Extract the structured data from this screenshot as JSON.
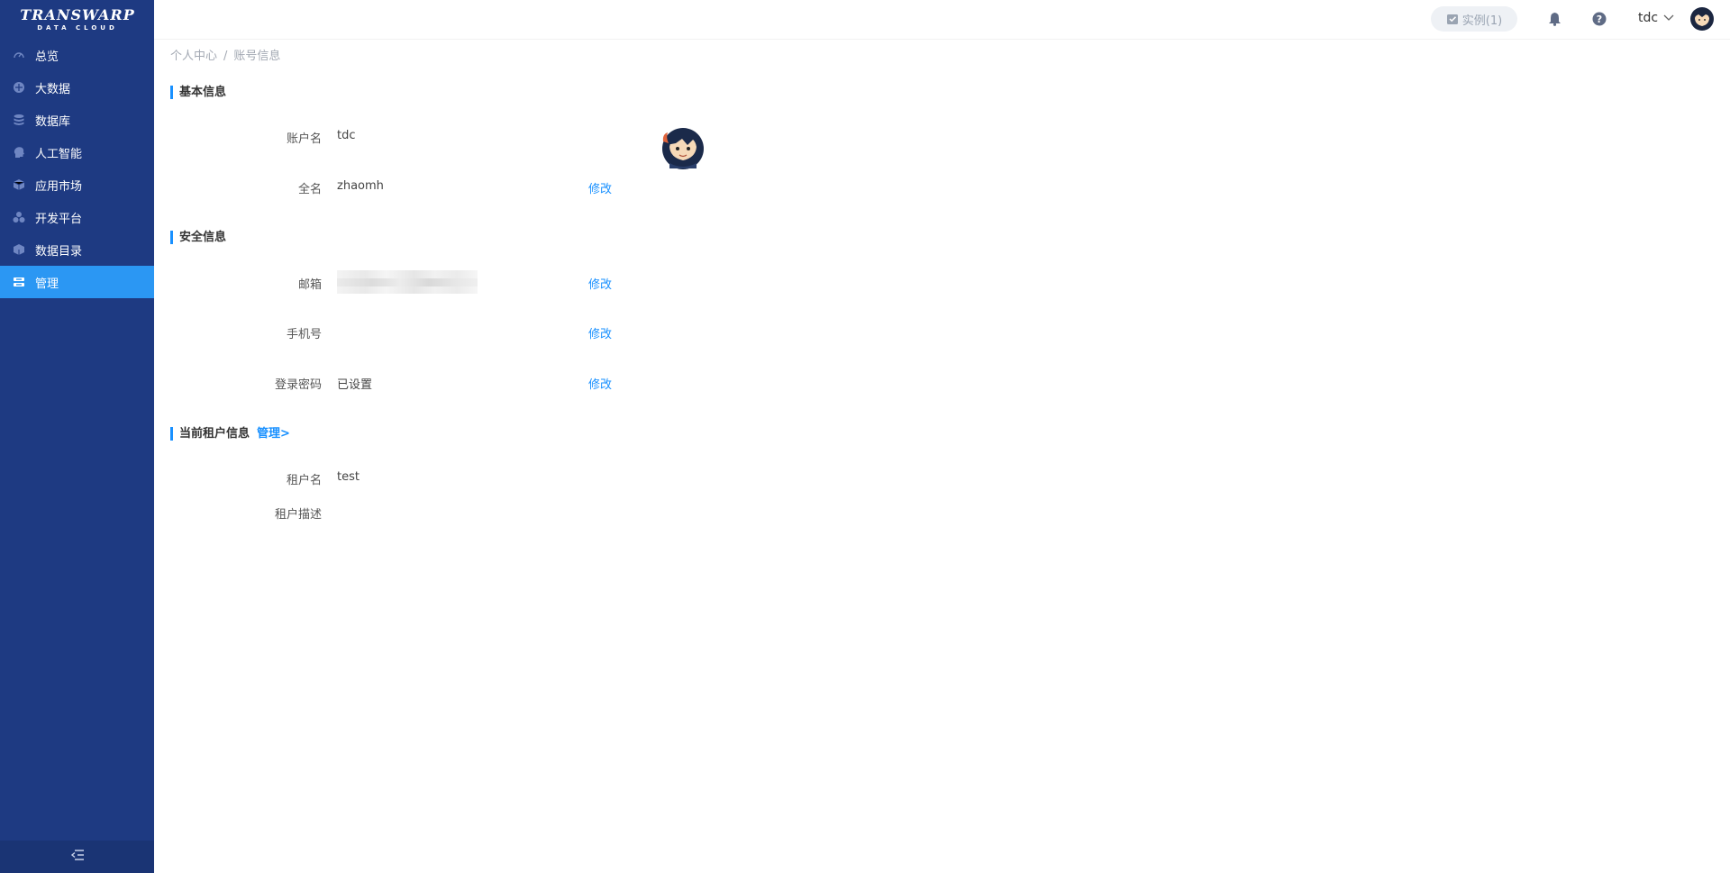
{
  "logo": {
    "line1": "TRANSWARP",
    "line2": "DATA CLOUD"
  },
  "sidebar": {
    "items": [
      {
        "label": "总览",
        "icon": "dashboard-gauge-icon",
        "active": false
      },
      {
        "label": "大数据",
        "icon": "big-data-icon",
        "active": false
      },
      {
        "label": "数据库",
        "icon": "database-icon",
        "active": false
      },
      {
        "label": "人工智能",
        "icon": "ai-head-icon",
        "active": false
      },
      {
        "label": "应用市场",
        "icon": "app-market-icon",
        "active": false
      },
      {
        "label": "开发平台",
        "icon": "dev-platform-icon",
        "active": false
      },
      {
        "label": "数据目录",
        "icon": "data-catalog-icon",
        "active": false
      },
      {
        "label": "管理",
        "icon": "management-icon",
        "active": true
      }
    ],
    "collapse_icon": "collapse-menu-icon"
  },
  "header": {
    "instances_label": "实例(1)",
    "notifications_icon": "bell-icon",
    "help_icon": "help-icon",
    "username": "tdc"
  },
  "breadcrumb": {
    "items": [
      "个人中心",
      "账号信息"
    ],
    "separator": "/"
  },
  "basic_info": {
    "title": "基本信息",
    "account_label": "账户名",
    "account_value": "tdc",
    "fullname_label": "全名",
    "fullname_value": "zhaomh",
    "edit_label": "修改"
  },
  "security_info": {
    "title": "安全信息",
    "email_label": "邮箱",
    "email_edit": "修改",
    "phone_label": "手机号",
    "phone_edit": "修改",
    "password_label": "登录密码",
    "password_value": "已设置",
    "password_edit": "修改"
  },
  "tenant_info": {
    "title": "当前租户信息",
    "manage_link": "管理>",
    "tenant_name_label": "租户名",
    "tenant_name_value": "test",
    "tenant_desc_label": "租户描述"
  },
  "colors": {
    "sidebar_bg": "#1e3a82",
    "active_item": "#2b97f3",
    "link": "#1890ff",
    "accent_bar": "#1890ff"
  }
}
